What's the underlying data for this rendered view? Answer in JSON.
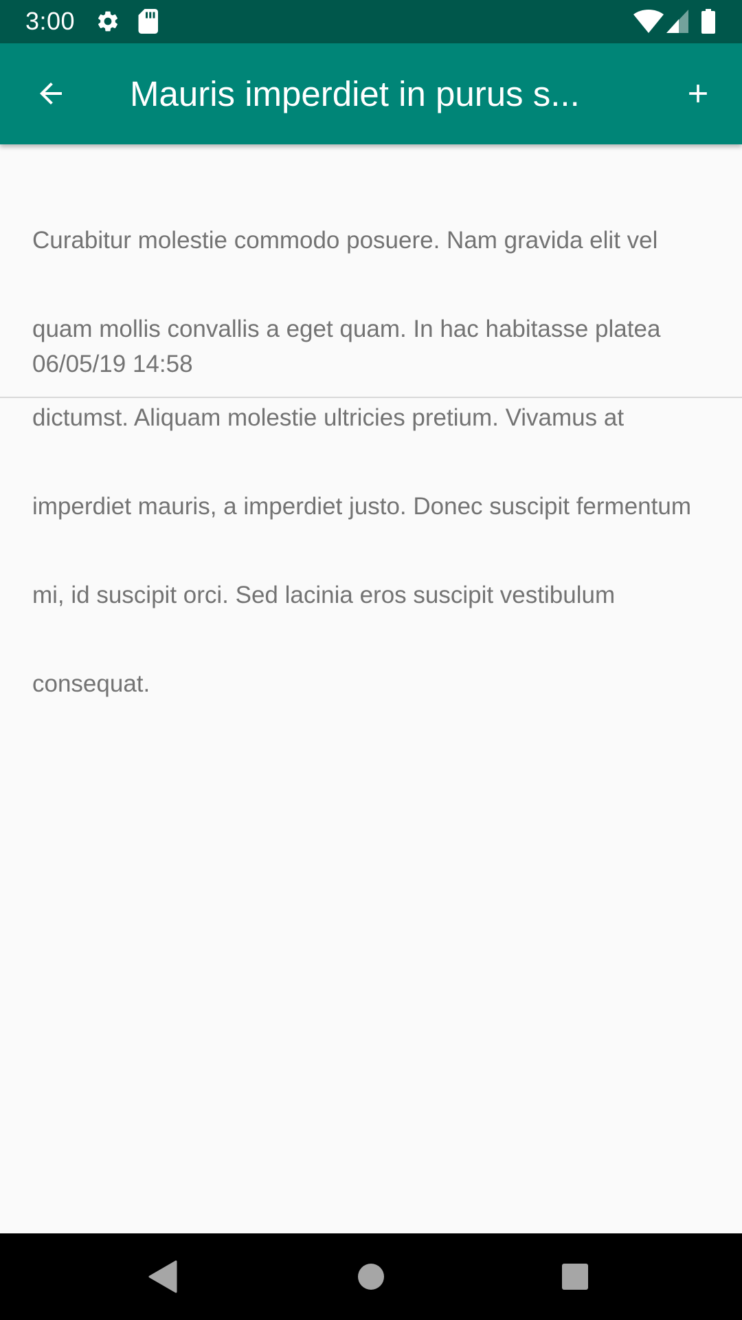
{
  "status_bar": {
    "time": "3:00",
    "icons": [
      "gear-icon",
      "sd-card-icon",
      "wifi-icon",
      "cell-signal-icon",
      "battery-icon"
    ],
    "background_color": "#00574b"
  },
  "toolbar": {
    "title": "Mauris imperdiet in purus s...",
    "back_icon": "arrow-back-icon",
    "add_icon": "plus-icon",
    "background_color": "#008577"
  },
  "note": {
    "body_lines": [
      "Curabitur molestie commodo posuere. Nam gravida elit vel",
      "quam mollis convallis a eget quam. In hac habitasse platea",
      "dictumst. Aliquam molestie ultricies pretium. Vivamus at",
      "imperdiet mauris, a imperdiet justo. Donec suscipit fermentum",
      "mi, id suscipit orci. Sed lacinia eros suscipit vestibulum",
      "consequat."
    ],
    "date": "06/05/19 14:58"
  },
  "nav_bar": {
    "icons": [
      "back-triangle-icon",
      "home-circle-icon",
      "recents-square-icon"
    ]
  }
}
